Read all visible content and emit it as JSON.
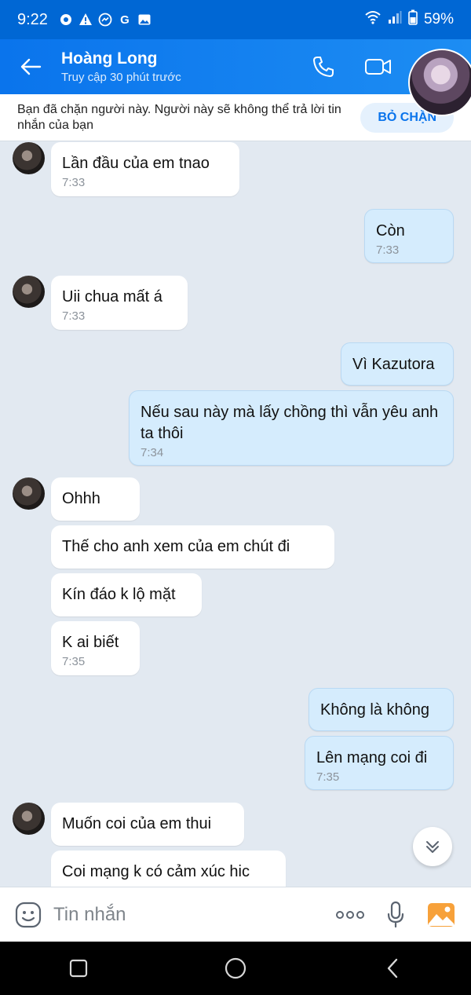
{
  "status": {
    "time": "9:22",
    "battery": "59%"
  },
  "header": {
    "name": "Hoàng Long",
    "subtitle": "Truy cập 30 phút trước"
  },
  "banner": {
    "text": "Bạn đã chặn người này. Người này sẽ không thể trả lời tin nhắn của bạn",
    "unblock": "BỎ CHẶN"
  },
  "messages": [
    {
      "text": "Lần đầu của em tnao",
      "time": "7:33"
    },
    {
      "text": "Còn",
      "time": "7:33"
    },
    {
      "text": "Uii chua mất á",
      "time": "7:33"
    },
    {
      "text": "Vì Kazutora"
    },
    {
      "text": "Nếu sau này mà lấy chồng thì vẫn yêu anh ta thôi",
      "time": "7:34"
    },
    {
      "text": "Ohhh"
    },
    {
      "text": "Thế cho anh xem của em chút đi"
    },
    {
      "text": "Kín đáo k lộ mặt"
    },
    {
      "text": "K ai biết",
      "time": "7:35"
    },
    {
      "text": "Không là không"
    },
    {
      "text": "Lên mạng coi đi",
      "time": "7:35"
    },
    {
      "text": "Muốn coi của em thui"
    },
    {
      "text": "Coi mạng k có cảm xúc hic"
    }
  ],
  "input": {
    "placeholder": "Tin nhắn"
  },
  "colors": {
    "header": "#0a74ec",
    "my_bubble": "#d5ecfd",
    "background": "#e2e9f1"
  }
}
